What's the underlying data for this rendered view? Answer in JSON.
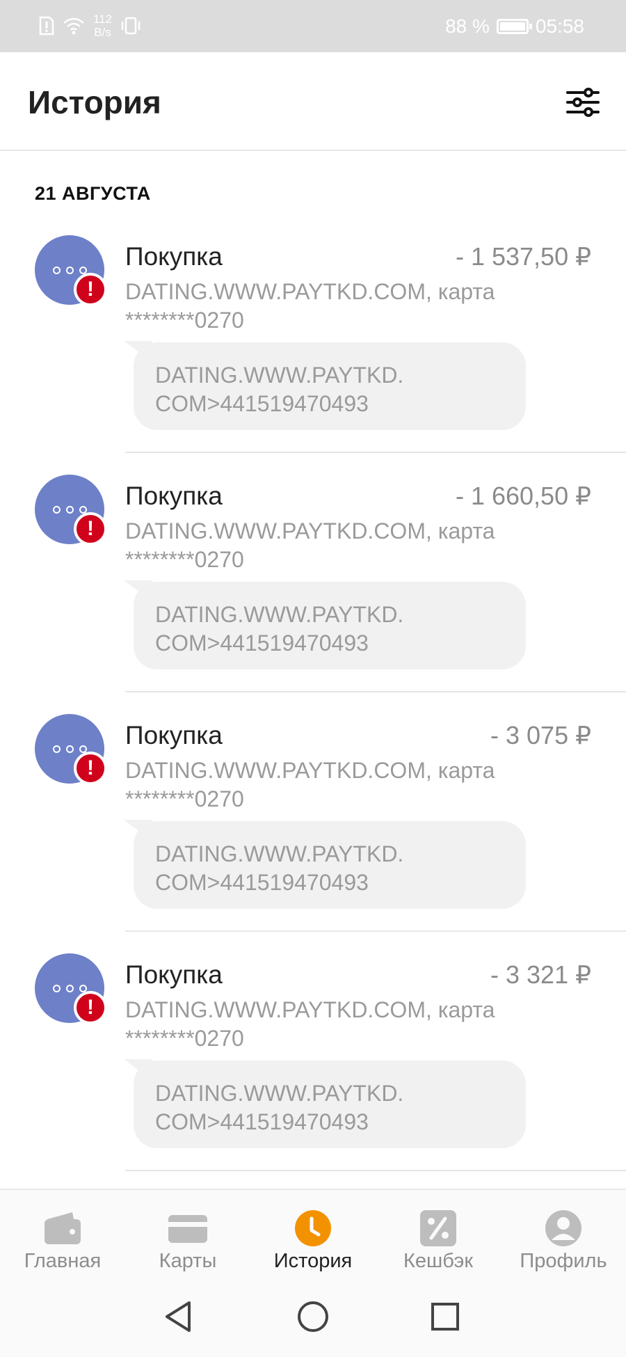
{
  "status_bar": {
    "speed_value": "112",
    "speed_unit": "B/s",
    "battery": "88 %",
    "time": "05:58"
  },
  "header": {
    "title": "История"
  },
  "section": {
    "date_label": "21 АВГУСТА"
  },
  "transactions": [
    {
      "title": "Покупка",
      "amount": "- 1 537,50 ₽",
      "description": "DATING.WWW.PAYTKD.COM, карта ********0270",
      "comment": "DATING.WWW.PAYTKD. COM>441519470493"
    },
    {
      "title": "Покупка",
      "amount": "- 1 660,50 ₽",
      "description": "DATING.WWW.PAYTKD.COM, карта ********0270",
      "comment": "DATING.WWW.PAYTKD. COM>441519470493"
    },
    {
      "title": "Покупка",
      "amount": "- 3 075 ₽",
      "description": "DATING.WWW.PAYTKD.COM, карта ********0270",
      "comment": "DATING.WWW.PAYTKD. COM>441519470493"
    },
    {
      "title": "Покупка",
      "amount": "- 3 321 ₽",
      "description": "DATING.WWW.PAYTKD.COM, карта ********0270",
      "comment": "DATING.WWW.PAYTKD. COM>441519470493"
    }
  ],
  "bottom_nav": {
    "items": [
      {
        "label": "Главная",
        "icon": "wallet-icon"
      },
      {
        "label": "Карты",
        "icon": "card-icon"
      },
      {
        "label": "История",
        "icon": "clock-icon",
        "active": true
      },
      {
        "label": "Кешбэк",
        "icon": "percent-icon"
      },
      {
        "label": "Профиль",
        "icon": "profile-icon"
      }
    ]
  },
  "colors": {
    "accent": "#f39200",
    "avatar": "#6d80c8",
    "alert": "#d0021b"
  }
}
